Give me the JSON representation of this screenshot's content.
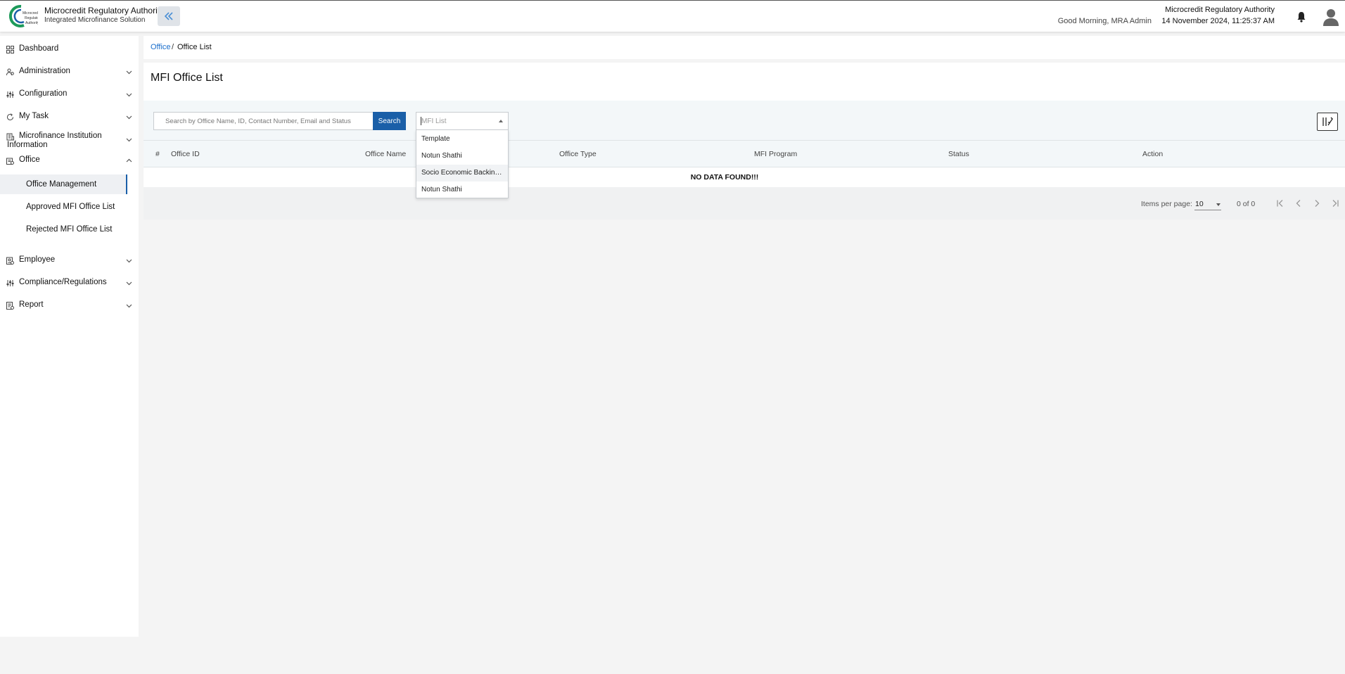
{
  "header": {
    "brand_title": "Microcredit Regulatory Authority",
    "brand_subtitle": "Integrated Microfinance Solution",
    "logo_text": "Microcredit Regulatory Authority",
    "greeting": "Good Morning, MRA Admin",
    "org_name": "Microcredit Regulatory Authority",
    "datetime": "14 November 2024, 11:25:37 AM"
  },
  "sidebar": {
    "items": [
      {
        "label": "Dashboard",
        "icon": "grid-icon"
      },
      {
        "label": "Administration",
        "icon": "users-icon"
      },
      {
        "label": "Configuration",
        "icon": "sliders-icon"
      },
      {
        "label": "My Task",
        "icon": "refresh-icon"
      },
      {
        "label": "Microfinance Institution Information",
        "icon": "building-icon"
      },
      {
        "label": "Office",
        "icon": "office-icon"
      },
      {
        "label": "Employee",
        "icon": "id-card-icon"
      },
      {
        "label": "Compliance/Regulations",
        "icon": "sliders-icon"
      },
      {
        "label": "Report",
        "icon": "report-icon"
      }
    ],
    "office_sub_items": [
      {
        "label": "Office Management"
      },
      {
        "label": "Approved MFI Office List"
      },
      {
        "label": "Rejected MFI Office List"
      }
    ]
  },
  "breadcrumb": {
    "parent": "Office",
    "separator": "/",
    "current": "Office List"
  },
  "page": {
    "title": "MFI Office List"
  },
  "filters": {
    "search_placeholder": "Search by Office Name, ID, Contact Number, Email and Status",
    "search_label": "Search",
    "mfi_placeholder": "MFI List",
    "mfi_options": [
      "Template",
      "Notun Shathi",
      "Socio Economic Backing A...",
      "Notun Shathi"
    ]
  },
  "table": {
    "columns": [
      "#",
      "Office ID",
      "Office Name",
      "Office Type",
      "MFI Program",
      "Status",
      "Action"
    ],
    "empty_message": "NO DATA FOUND!!!"
  },
  "paginator": {
    "items_per_page_label": "Items per page:",
    "items_per_page": "10",
    "range": "0 of 0"
  },
  "colors": {
    "primary": "#1a5fa8",
    "link": "#1a6ecc",
    "logo_green": "#1d9a5a"
  }
}
